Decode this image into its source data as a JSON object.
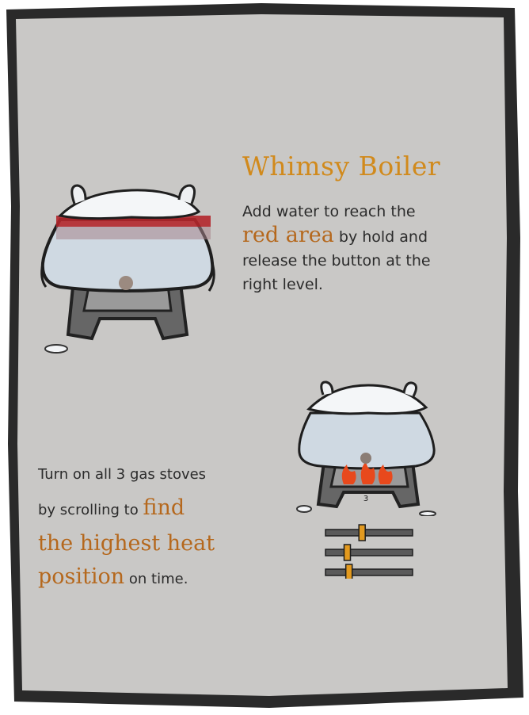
{
  "title": "Whimsy Boiler",
  "instruction1": {
    "line1": "Add water to reach the",
    "highlight": "red area",
    "line2_rest": " by hold and",
    "line3": "release the button at the",
    "line4": "right level."
  },
  "instruction2": {
    "line1": "Turn on all 3 gas stoves",
    "line2_pre": "by scrolling to ",
    "highlight1": "find",
    "highlight2": "the highest heat",
    "highlight3": "position",
    "line4_rest": " on time."
  },
  "stove_label": "3",
  "sliders": [
    0.42,
    0.25,
    0.27
  ],
  "colors": {
    "paper": "#c9c8c6",
    "title": "#d18a1c",
    "highlight": "#b5681d",
    "red_band": "#b3262b",
    "slider_track": "#5a5a5a",
    "slider_knob": "#e39a1f"
  }
}
